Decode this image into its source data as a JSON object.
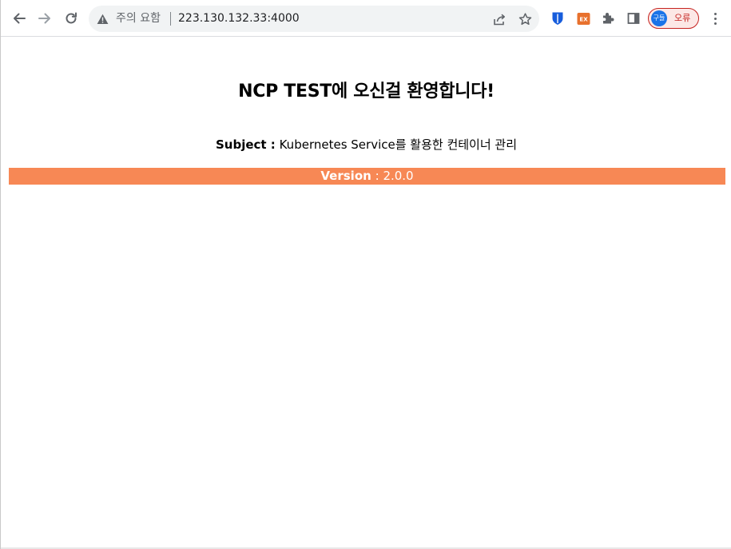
{
  "browser": {
    "security_label": "주의 요함",
    "url": "223.130.132.33:4000",
    "profile": {
      "avatar_text": "구들",
      "status_label": "오류"
    },
    "extensions": [
      "bitwarden-icon",
      "ex-extension-icon",
      "puzzle-icon",
      "side-panel-icon"
    ],
    "colors": {
      "omnibox_bg": "#f1f3f4",
      "profile_border": "#c5221f"
    }
  },
  "page": {
    "title": "NCP TEST에 오신걸 환영합니다!",
    "subject_label": "Subject :",
    "subject_value": "Kubernetes Service를 활용한 컨테이너 관리",
    "version_label": "Version",
    "version_sep": ":",
    "version_value": "2.0.0",
    "colors": {
      "version_bar": "#f78855",
      "text": "#000000"
    }
  }
}
